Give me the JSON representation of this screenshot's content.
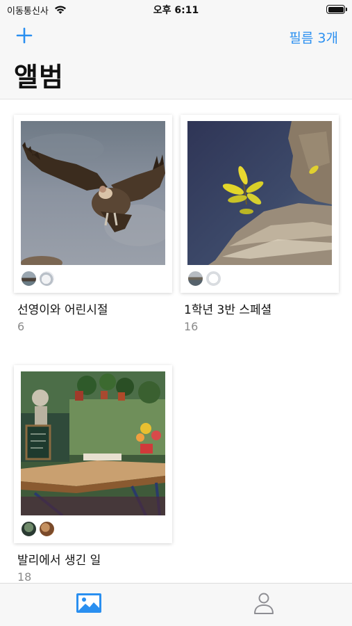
{
  "status_bar": {
    "carrier": "이동통신사",
    "time": "오후 6:11",
    "wifi_icon": "wifi-icon",
    "battery_icon": "battery-icon"
  },
  "nav": {
    "add_icon": "plus-icon",
    "film_count": "필름 3개",
    "title": "앨범"
  },
  "albums": [
    {
      "title": "선영이와 어린시절",
      "count": "6",
      "photo": "vulture",
      "avatars": [
        "avatar-1",
        "avatar-2"
      ]
    },
    {
      "title": "1학년 3반 스페셜",
      "count": "16",
      "photo": "yellow-plant-on-rock",
      "avatars": [
        "avatar-3",
        "avatar-4"
      ]
    },
    {
      "title": "발리에서 생긴 일",
      "count": "18",
      "photo": "cafe-terrace",
      "avatars": [
        "avatar-5",
        "avatar-6"
      ]
    }
  ],
  "tab_bar": {
    "tabs": [
      {
        "name": "albums",
        "icon": "photo-icon",
        "active": true
      },
      {
        "name": "profile",
        "icon": "person-icon",
        "active": false
      }
    ]
  },
  "colors": {
    "accent": "#2a8ff0",
    "inactive_tab": "#8e8e93",
    "count_text": "#8a8a8a"
  }
}
